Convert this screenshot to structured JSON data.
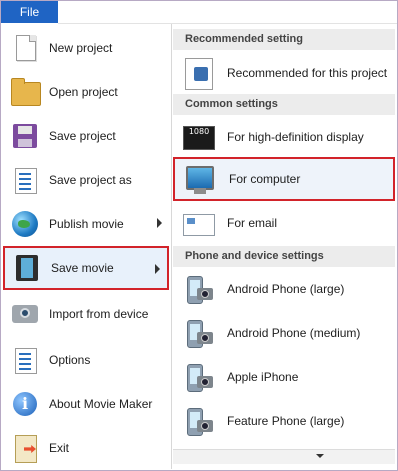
{
  "menu": {
    "file_label": "File"
  },
  "left_items": [
    {
      "label": "New project",
      "icon": "new-project-icon"
    },
    {
      "label": "Open project",
      "icon": "open-project-icon"
    },
    {
      "label": "Save project",
      "icon": "save-project-icon"
    },
    {
      "label": "Save project as",
      "icon": "save-project-as-icon"
    },
    {
      "label": "Publish movie",
      "icon": "publish-movie-icon"
    },
    {
      "label": "Save movie",
      "icon": "save-movie-icon"
    },
    {
      "label": "Import from device",
      "icon": "import-device-icon"
    },
    {
      "label": "Options",
      "icon": "options-icon"
    },
    {
      "label": "About Movie Maker",
      "icon": "about-icon"
    },
    {
      "label": "Exit",
      "icon": "exit-icon"
    }
  ],
  "right": {
    "section_recommended": "Recommended setting",
    "recommended_item": "Recommended for this project",
    "section_common": "Common settings",
    "hd_item": "For high-definition display",
    "computer_item": "For computer",
    "email_item": "For email",
    "hd_badge": "1080",
    "section_phone": "Phone and device settings",
    "phone_items": [
      "Android Phone (large)",
      "Android Phone (medium)",
      "Apple iPhone",
      "Feature Phone (large)"
    ]
  },
  "colors": {
    "accent": "#1f64c4",
    "highlight_border": "#d2232a",
    "header_bg": "#ececec"
  }
}
